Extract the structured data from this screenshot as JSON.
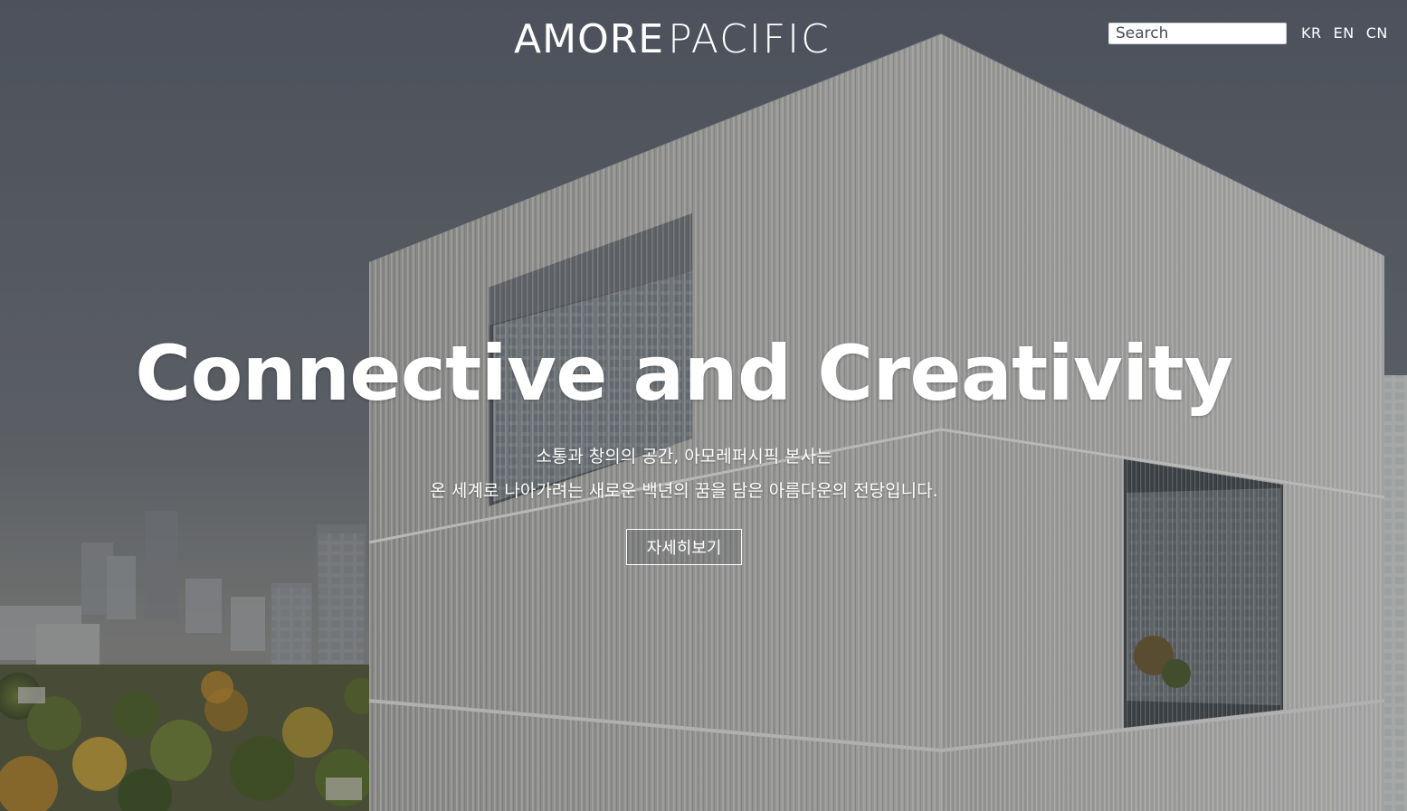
{
  "header": {
    "logo": {
      "word_a": "AMORE",
      "word_b": "PACIFIC"
    },
    "search": {
      "placeholder": "Search",
      "value": ""
    },
    "languages": [
      "KR",
      "EN",
      "CN"
    ]
  },
  "hero": {
    "title": "Connective and Creativity",
    "description_lines": [
      "소통과 창의의 공간, 아모레퍼시픽 본사는",
      "온 세계로 나아가려는 새로운 백년의 꿈을 담은 아름다운의 전당입니다."
    ],
    "button_label": "자세히보기",
    "background_image": "amorepacific-headquarters-building-photo"
  },
  "colors": {
    "sky_top": "#5a606b",
    "building_light": "#cfcfcc",
    "building_dark": "#9a9894",
    "text": "#ffffff"
  }
}
